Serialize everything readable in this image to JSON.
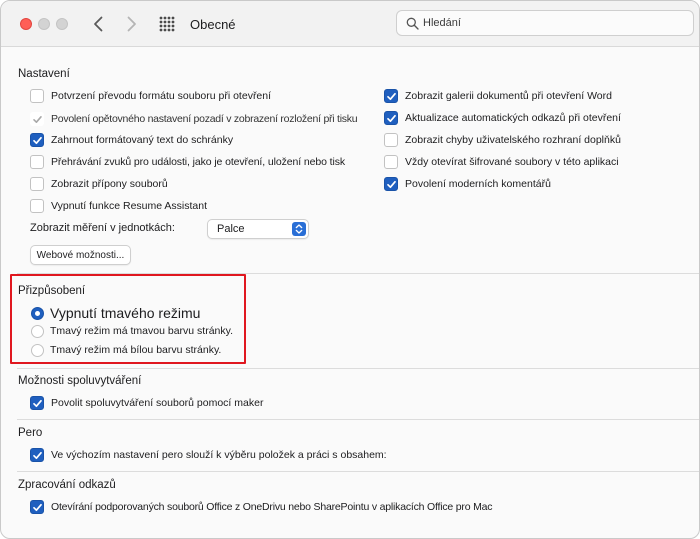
{
  "window": {
    "title": "Obecné",
    "search_placeholder": "Hledání"
  },
  "icons": {
    "back": "chevron-left-icon",
    "forward": "chevron-right-icon",
    "grid": "grid-icon",
    "search": "search-icon"
  },
  "colors": {
    "accent": "#1f5fbf",
    "highlight_border": "#e0171f",
    "close_button": "#ff5f57"
  },
  "settings": {
    "title": "Nastavení",
    "left_options": [
      {
        "label": "Potvrzení převodu formátu souboru při otevření",
        "checked": false
      },
      {
        "label": "Povolení opětovného nastavení pozadí v zobrazení rozložení při tisku",
        "checked": true,
        "disabled": true
      },
      {
        "label": "Zahrnout formátovaný text do schránky",
        "checked": true
      },
      {
        "label": "Přehrávání zvuků pro události, jako je otevření, uložení nebo tisk",
        "checked": false
      },
      {
        "label": "Zobrazit přípony souborů",
        "checked": false
      },
      {
        "label": "Vypnutí funkce Resume Assistant",
        "checked": false
      }
    ],
    "right_options": [
      {
        "label": "Zobrazit galerii dokumentů při otevření Word",
        "checked": true
      },
      {
        "label": "Aktualizace automatických odkazů při otevření",
        "checked": true
      },
      {
        "label": "Zobrazit chyby uživatelského rozhraní doplňků",
        "checked": false
      },
      {
        "label": "Vždy otevírat šifrované soubory v této aplikaci",
        "checked": false
      },
      {
        "label": "Povolení moderních komentářů",
        "checked": true
      }
    ],
    "units_label": "Zobrazit měření v jednotkách:",
    "units_value": "Palce",
    "web_options_button": "Webové možnosti..."
  },
  "personalization": {
    "title": "Přizpůsobení",
    "options": [
      {
        "label": "Vypnutí tmavého režimu",
        "selected": true
      },
      {
        "label": "Tmavý režim má tmavou barvu stránky.",
        "selected": false
      },
      {
        "label": "Tmavý režim má bílou barvu stránky.",
        "selected": false
      }
    ]
  },
  "coauthoring": {
    "title": "Možnosti spoluvytváření",
    "options": [
      {
        "label": "Povolit spoluvytváření souborů pomocí maker",
        "checked": true
      }
    ]
  },
  "pen": {
    "title": "Pero",
    "options": [
      {
        "label": "Ve výchozím nastavení pero slouží k výběru položek a práci s obsahem:",
        "checked": true
      }
    ]
  },
  "links": {
    "title": "Zpracování odkazů",
    "options": [
      {
        "label": "Otevírání podporovaných souborů Office z OneDrivu nebo SharePointu v aplikacích Office pro Mac",
        "checked": true
      }
    ]
  }
}
